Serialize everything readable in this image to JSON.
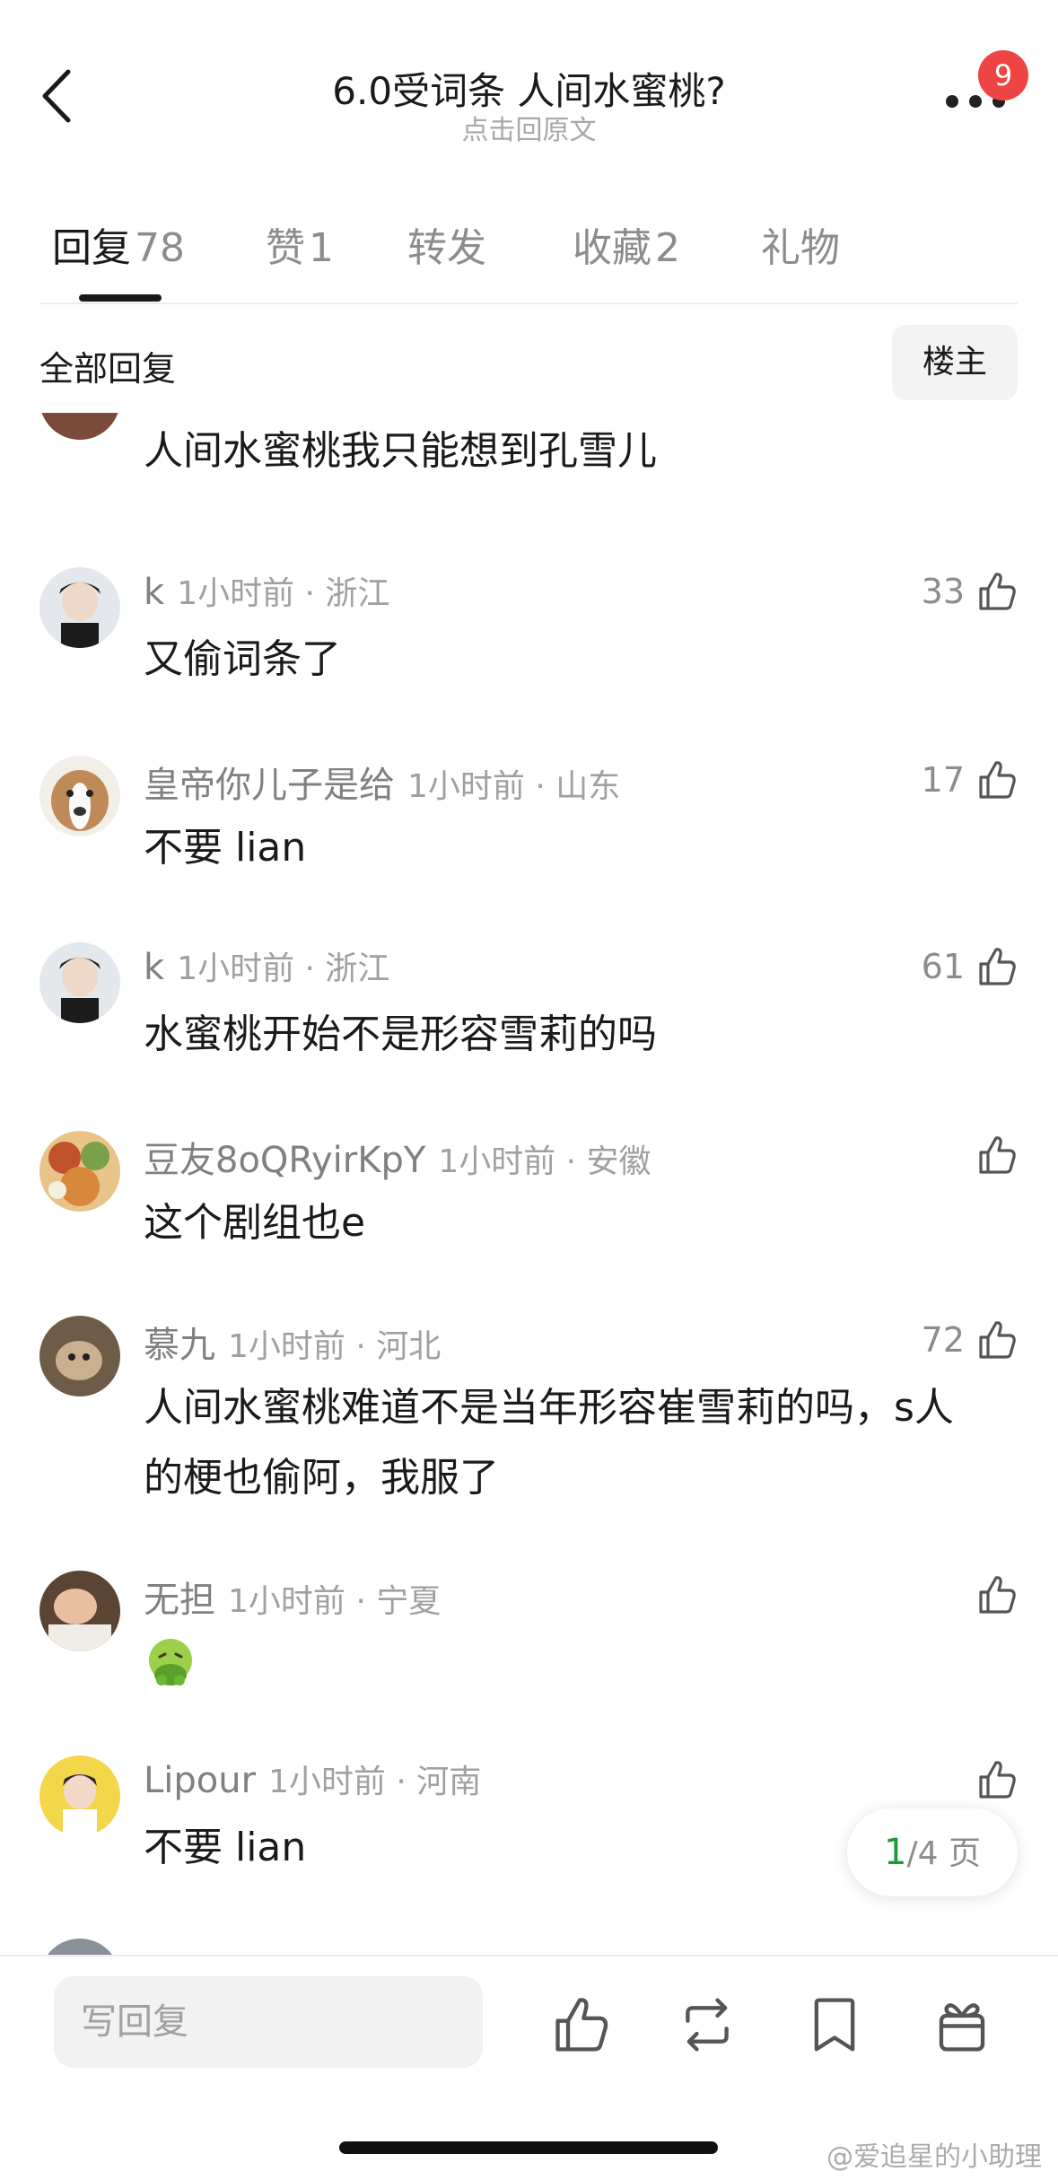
{
  "header": {
    "title": "6.0受词条 人间水蜜桃?",
    "subtitle": "点击回原文",
    "badge_count": "9"
  },
  "tabs": [
    {
      "label": "回复",
      "count": "78"
    },
    {
      "label": "赞",
      "count": "1"
    },
    {
      "label": "转发",
      "count": ""
    },
    {
      "label": "收藏",
      "count": "2"
    },
    {
      "label": "礼物",
      "count": ""
    }
  ],
  "filter": {
    "label": "全部回复",
    "owner_button": "楼主"
  },
  "comments": [
    {
      "user": "",
      "time": "",
      "text": "人间水蜜桃我只能想到孔雪儿",
      "likes": "",
      "avatar_color": "#7a4a3a"
    },
    {
      "user": "k",
      "time": "1小时前 · 浙江",
      "text": "又偷词条了",
      "likes": "33",
      "avatar_color": "#d8dde3"
    },
    {
      "user": "皇帝你儿子是给",
      "time": "1小时前 · 山东",
      "text": "不要 lian",
      "likes": "17",
      "avatar_color": "#b98555"
    },
    {
      "user": "k",
      "time": "1小时前 · 浙江",
      "text": "水蜜桃开始不是形容雪莉的吗",
      "likes": "61",
      "avatar_color": "#d8dde3"
    },
    {
      "user": "豆友8oQRyirKpY",
      "time": "1小时前 · 安徽",
      "text": "这个剧组也e",
      "likes": "",
      "avatar_color": "#c9823e"
    },
    {
      "user": "慕九",
      "time": "1小时前 · 河北",
      "text": "人间水蜜桃难道不是当年形容崔雪莉的吗，s人的梗也偷阿，我服了",
      "likes": "72",
      "avatar_color": "#8a7560"
    },
    {
      "user": "无担",
      "time": "1小时前 · 宁夏",
      "text": "🤮",
      "likes": "",
      "avatar_color": "#6b4e3c"
    },
    {
      "user": "Lipour",
      "time": "1小时前 · 河南",
      "text": "不要 lian",
      "likes": "",
      "avatar_color": "#f0d060"
    }
  ],
  "pager": {
    "current": "1",
    "total_label": "/4 页"
  },
  "bottom_bar": {
    "reply_placeholder": "写回复"
  },
  "watermark": "@爱追星的小助理"
}
